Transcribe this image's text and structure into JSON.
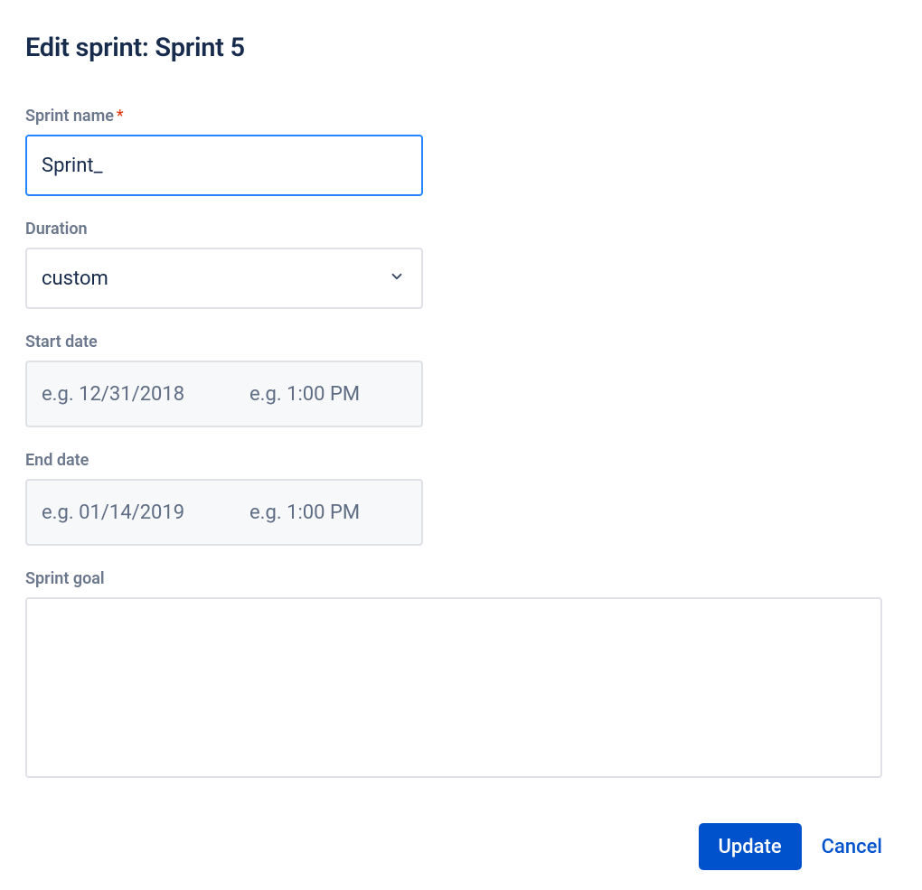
{
  "dialog": {
    "title": "Edit sprint: Sprint 5"
  },
  "fields": {
    "sprint_name": {
      "label": "Sprint name",
      "required_mark": "*",
      "value": "Sprint_"
    },
    "duration": {
      "label": "Duration",
      "value": "custom"
    },
    "start_date": {
      "label": "Start date",
      "date_placeholder": "e.g. 12/31/2018",
      "time_placeholder": "e.g. 1:00 PM",
      "date_value": "",
      "time_value": ""
    },
    "end_date": {
      "label": "End date",
      "date_placeholder": "e.g. 01/14/2019",
      "time_placeholder": "e.g. 1:00 PM",
      "date_value": "",
      "time_value": ""
    },
    "sprint_goal": {
      "label": "Sprint goal",
      "value": ""
    }
  },
  "actions": {
    "update_label": "Update",
    "cancel_label": "Cancel"
  }
}
